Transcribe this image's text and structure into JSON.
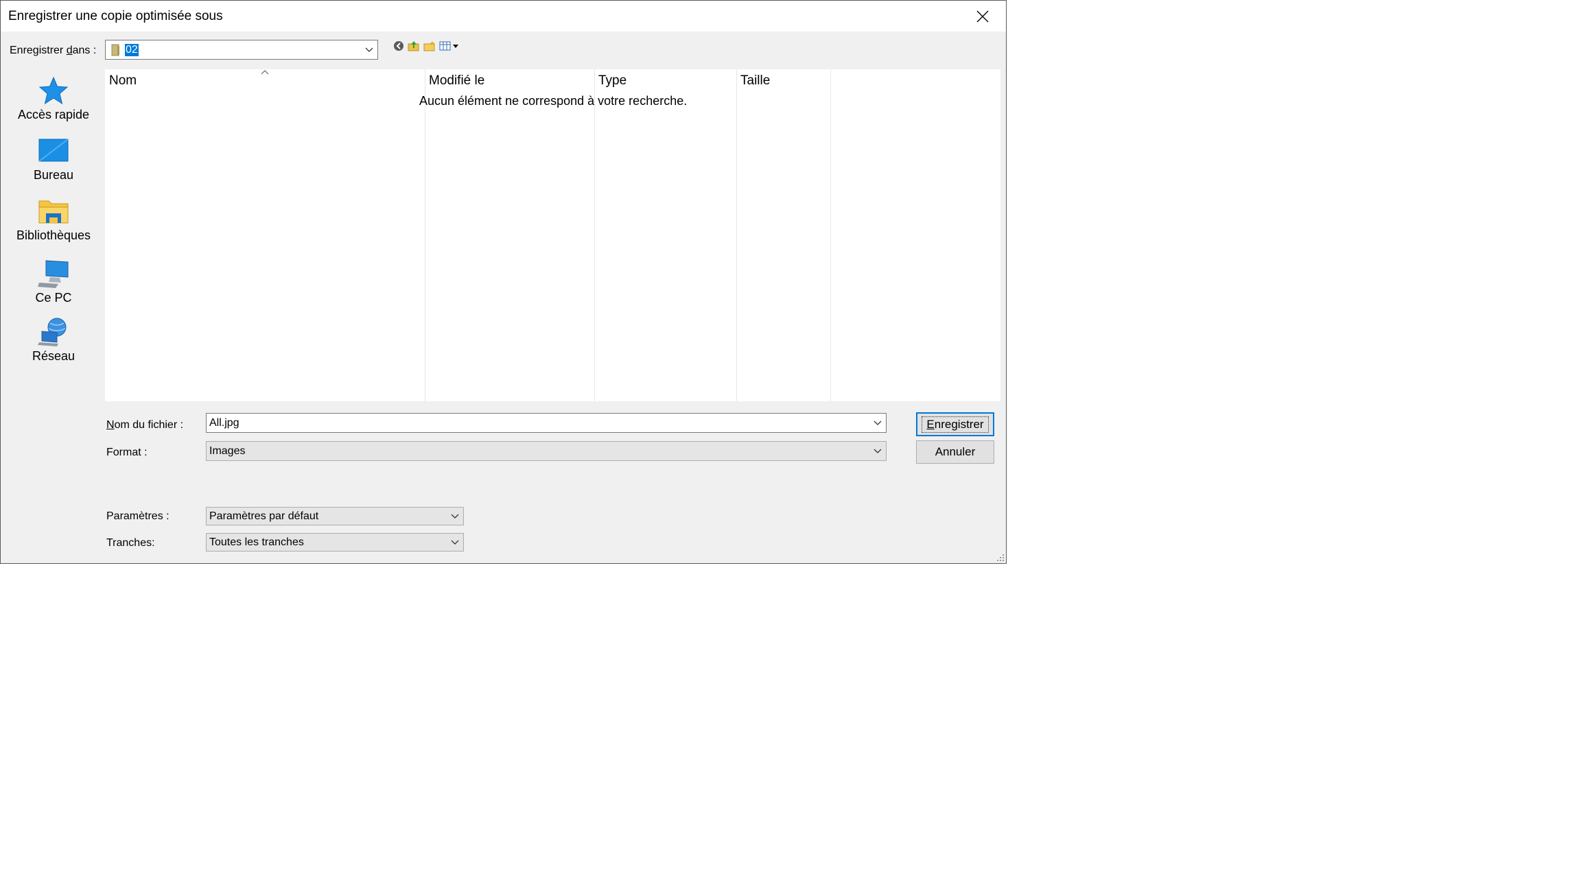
{
  "dialog": {
    "title": "Enregistrer une copie optimisée sous",
    "close_icon": "close-icon"
  },
  "location": {
    "label_pre": "Enregistrer ",
    "label_underlined": "d",
    "label_post": "ans :",
    "value": "02",
    "icon": "folder-icon"
  },
  "toolbar": {
    "icons": [
      "back-icon",
      "up-folder-icon",
      "new-folder-icon",
      "view-menu-icon"
    ]
  },
  "places": [
    {
      "label": "Accès rapide",
      "icon": "star-icon"
    },
    {
      "label": "Bureau",
      "icon": "desktop-icon"
    },
    {
      "label": "Bibliothèques",
      "icon": "libraries-icon"
    },
    {
      "label": "Ce PC",
      "icon": "computer-icon"
    },
    {
      "label": "Réseau",
      "icon": "network-icon"
    }
  ],
  "filelist": {
    "columns": [
      "Nom",
      "Modifié le",
      "Type",
      "Taille"
    ],
    "empty_message": "Aucun élément ne correspond à votre recherche."
  },
  "filename": {
    "label_underlined": "N",
    "label_post": "om du fichier :",
    "value": "All.jpg"
  },
  "format": {
    "label": "Format :",
    "value": "Images"
  },
  "settings": {
    "label": "Paramètres :",
    "value": "Paramètres par défaut"
  },
  "slices": {
    "label": "Tranches:",
    "value": "Toutes les tranches"
  },
  "buttons": {
    "save_underlined": "E",
    "save_post": "nregistrer",
    "cancel": "Annuler"
  },
  "colors": {
    "accent": "#0078d7",
    "dialog_bg": "#f0f0f0"
  }
}
